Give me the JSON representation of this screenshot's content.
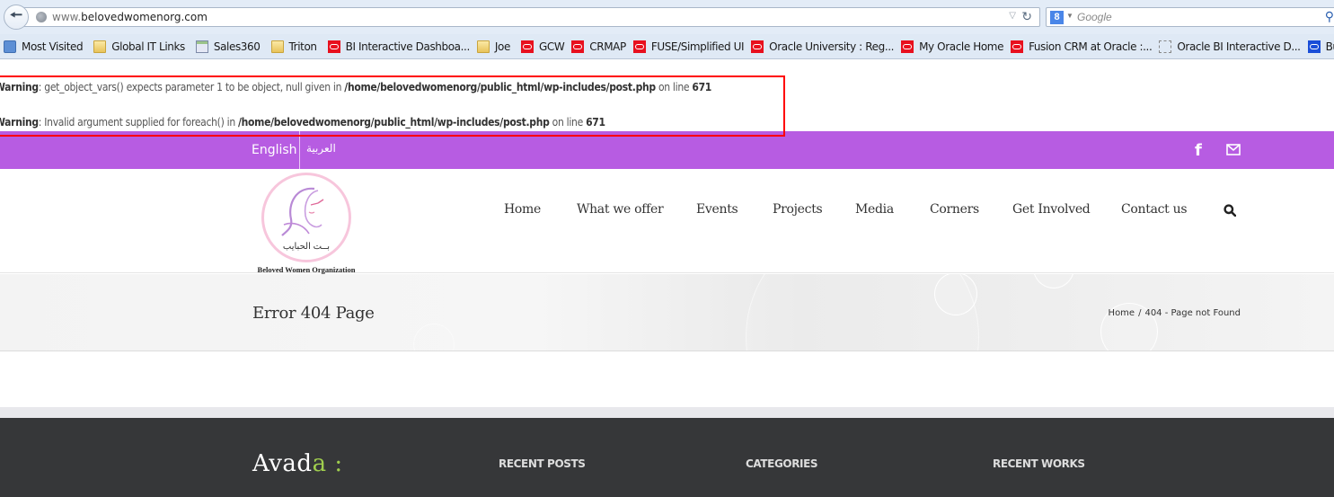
{
  "browser": {
    "url_prefix": "www.",
    "url_domain": "belovedwomenorg.com",
    "search_placeholder": "Google",
    "bookmarks": [
      {
        "label": "Most Visited",
        "icon": "most-visited-icon"
      },
      {
        "label": "Global IT Links",
        "icon": "folder-icon"
      },
      {
        "label": "Sales360",
        "icon": "page-icon"
      },
      {
        "label": "Triton",
        "icon": "folder-icon"
      },
      {
        "label": "BI Interactive Dashboa...",
        "icon": "oracle-icon"
      },
      {
        "label": "Joe",
        "icon": "folder-icon"
      },
      {
        "label": "GCW",
        "icon": "oracle-icon"
      },
      {
        "label": "CRMAP",
        "icon": "oracle-icon"
      },
      {
        "label": "FUSE/Simplified UI",
        "icon": "oracle-icon"
      },
      {
        "label": "Oracle University : Reg...",
        "icon": "oracle-icon"
      },
      {
        "label": "My Oracle Home",
        "icon": "oracle-icon"
      },
      {
        "label": "Fusion CRM at Oracle :...",
        "icon": "oracle-icon"
      },
      {
        "label": "Oracle BI Interactive D...",
        "icon": "blank-page-icon"
      },
      {
        "label": "BugSmart",
        "icon": "bugsmart-icon"
      }
    ]
  },
  "warnings": [
    {
      "label": "Warning",
      "message": ": get_object_vars() expects parameter 1 to be object, null given in ",
      "path": "/home/belovedwomenorg/public_html/wp-includes/post.php",
      "on_line": " on line ",
      "line": "671"
    },
    {
      "label": "Warning",
      "message": ": Invalid argument supplied for foreach() in ",
      "path": "/home/belovedwomenorg/public_html/wp-includes/post.php",
      "on_line": " on line ",
      "line": "671"
    }
  ],
  "topbar": {
    "lang_english": "English",
    "lang_arabic": "العربية",
    "color": "#b75ce2"
  },
  "logo": {
    "arabic_name": "بــت الحبايب",
    "english_name": "Beloved Women Organization"
  },
  "nav": {
    "items": [
      "Home",
      "What we offer",
      "Events",
      "Projects",
      "Media",
      "Corners",
      "Get Involved",
      "Contact us"
    ]
  },
  "page": {
    "title": "Error 404 Page",
    "breadcrumb_home": "Home",
    "breadcrumb_sep": "/",
    "breadcrumb_current": "404 - Page not Found"
  },
  "footer": {
    "logo_text": "Avad",
    "logo_accent": "a",
    "logo_colon": " :",
    "headings": [
      "RECENT POSTS",
      "CATEGORIES",
      "RECENT WORKS"
    ],
    "accent_color": "#a0ce4e"
  }
}
